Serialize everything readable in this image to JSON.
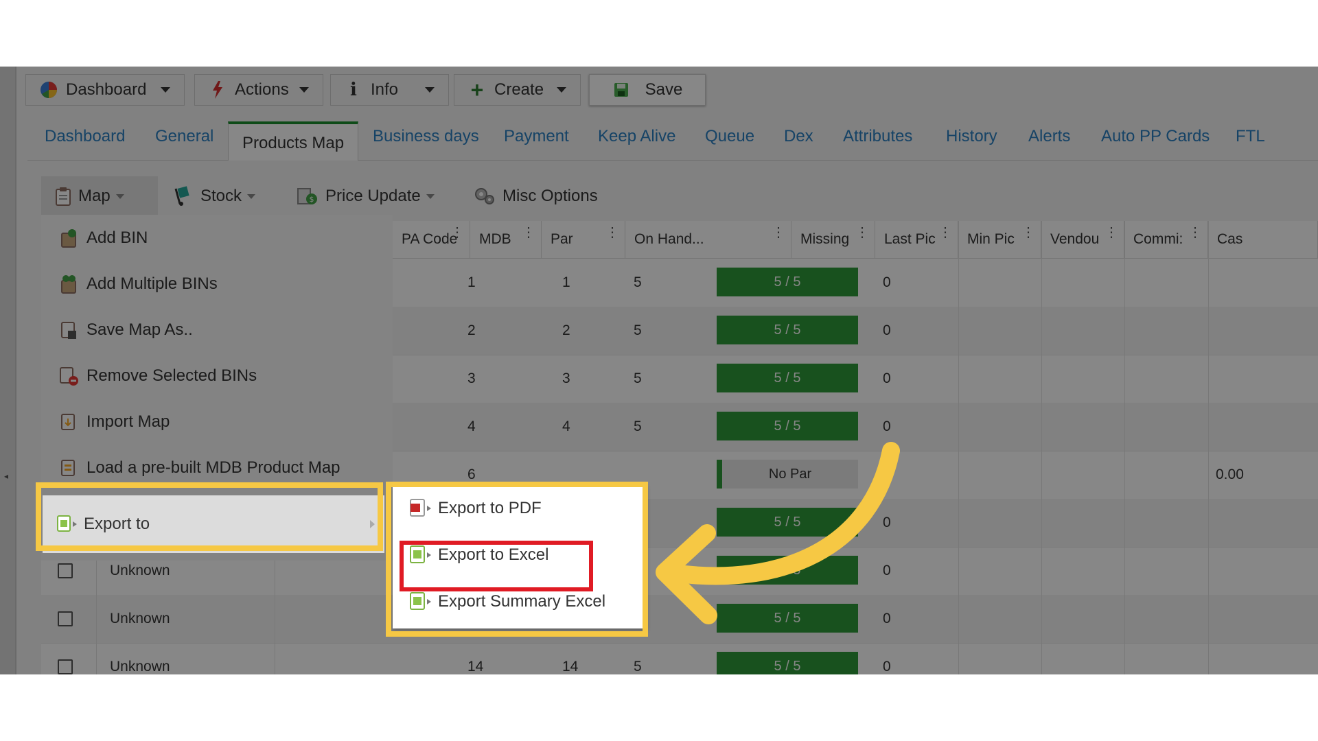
{
  "toolbar": {
    "dashboard_label": "Dashboard",
    "actions_label": "Actions",
    "info_label": "Info",
    "create_label": "Create",
    "save_label": "Save"
  },
  "tabs": [
    {
      "label": "Dashboard"
    },
    {
      "label": "General"
    },
    {
      "label": "Products Map",
      "active": true
    },
    {
      "label": "Business days"
    },
    {
      "label": "Payment"
    },
    {
      "label": "Keep Alive"
    },
    {
      "label": "Queue"
    },
    {
      "label": "Dex"
    },
    {
      "label": "Attributes"
    },
    {
      "label": "History"
    },
    {
      "label": "Alerts"
    },
    {
      "label": "Auto PP Cards"
    },
    {
      "label": "FTL"
    }
  ],
  "subtoolbar": {
    "map_label": "Map",
    "stock_label": "Stock",
    "price_update_label": "Price Update",
    "misc_label": "Misc Options"
  },
  "map_menu": {
    "items": [
      {
        "label": "Add BIN"
      },
      {
        "label": "Add Multiple BINs"
      },
      {
        "label": "Save Map As.."
      },
      {
        "label": "Remove Selected BINs"
      },
      {
        "label": "Import Map"
      },
      {
        "label": "Load a pre-built MDB Product Map"
      },
      {
        "label": "Export to"
      }
    ]
  },
  "export_submenu": {
    "items": [
      {
        "label": "Export to PDF"
      },
      {
        "label": "Export to Excel"
      },
      {
        "label": "Export Summary Excel"
      }
    ]
  },
  "grid": {
    "columns": [
      "PA Code",
      "MDB",
      "Par",
      "On Hand...",
      "Missing",
      "Last Pic",
      "Min Pic",
      "Vendou",
      "Commi:",
      "Cas"
    ],
    "rows": [
      {
        "name": "",
        "pa": "1",
        "mdb": "1",
        "par": "5",
        "onhand": "5 / 5",
        "missing": "0",
        "commi": ""
      },
      {
        "name": "",
        "pa": "2",
        "mdb": "2",
        "par": "5",
        "onhand": "5 / 5",
        "missing": "0",
        "commi": ""
      },
      {
        "name": "",
        "pa": "3",
        "mdb": "3",
        "par": "5",
        "onhand": "5 / 5",
        "missing": "0",
        "commi": ""
      },
      {
        "name": "",
        "pa": "4",
        "mdb": "4",
        "par": "5",
        "onhand": "5 / 5",
        "missing": "0",
        "commi": ""
      },
      {
        "name": "",
        "pa": "6",
        "mdb": "",
        "par": "",
        "onhand": "No Par",
        "missing": "",
        "commi": "0.00"
      },
      {
        "name": "",
        "pa": "",
        "mdb": "",
        "par": "",
        "onhand": "5 / 5",
        "missing": "0",
        "commi": ""
      },
      {
        "name": "Unknown",
        "pa": "",
        "mdb": "",
        "par": "",
        "onhand": "5 / 5",
        "missing": "0",
        "commi": ""
      },
      {
        "name": "Unknown",
        "pa": "",
        "mdb": "",
        "par": "",
        "onhand": "5 / 5",
        "missing": "0",
        "commi": ""
      },
      {
        "name": "Unknown",
        "pa": "14",
        "mdb": "14",
        "par": "5",
        "onhand": "5 / 5",
        "missing": "0",
        "commi": ""
      }
    ]
  },
  "colors": {
    "accent_tab": "#1b8f2e",
    "link": "#2a7fc1",
    "bar_green": "#2f9a3a",
    "highlight_yellow": "#f6c844",
    "highlight_red": "#e01b24"
  },
  "icons": [
    "pie-chart-icon",
    "lightning-icon",
    "info-icon",
    "plus-icon",
    "save-disk-icon",
    "clipboard-icon",
    "hand-truck-icon",
    "price-tag-icon",
    "gears-icon",
    "add-bin-icon",
    "add-multiple-icon",
    "save-map-icon",
    "remove-icon",
    "import-icon",
    "load-map-icon",
    "export-icon",
    "pdf-icon",
    "excel-icon",
    "summary-excel-icon"
  ]
}
